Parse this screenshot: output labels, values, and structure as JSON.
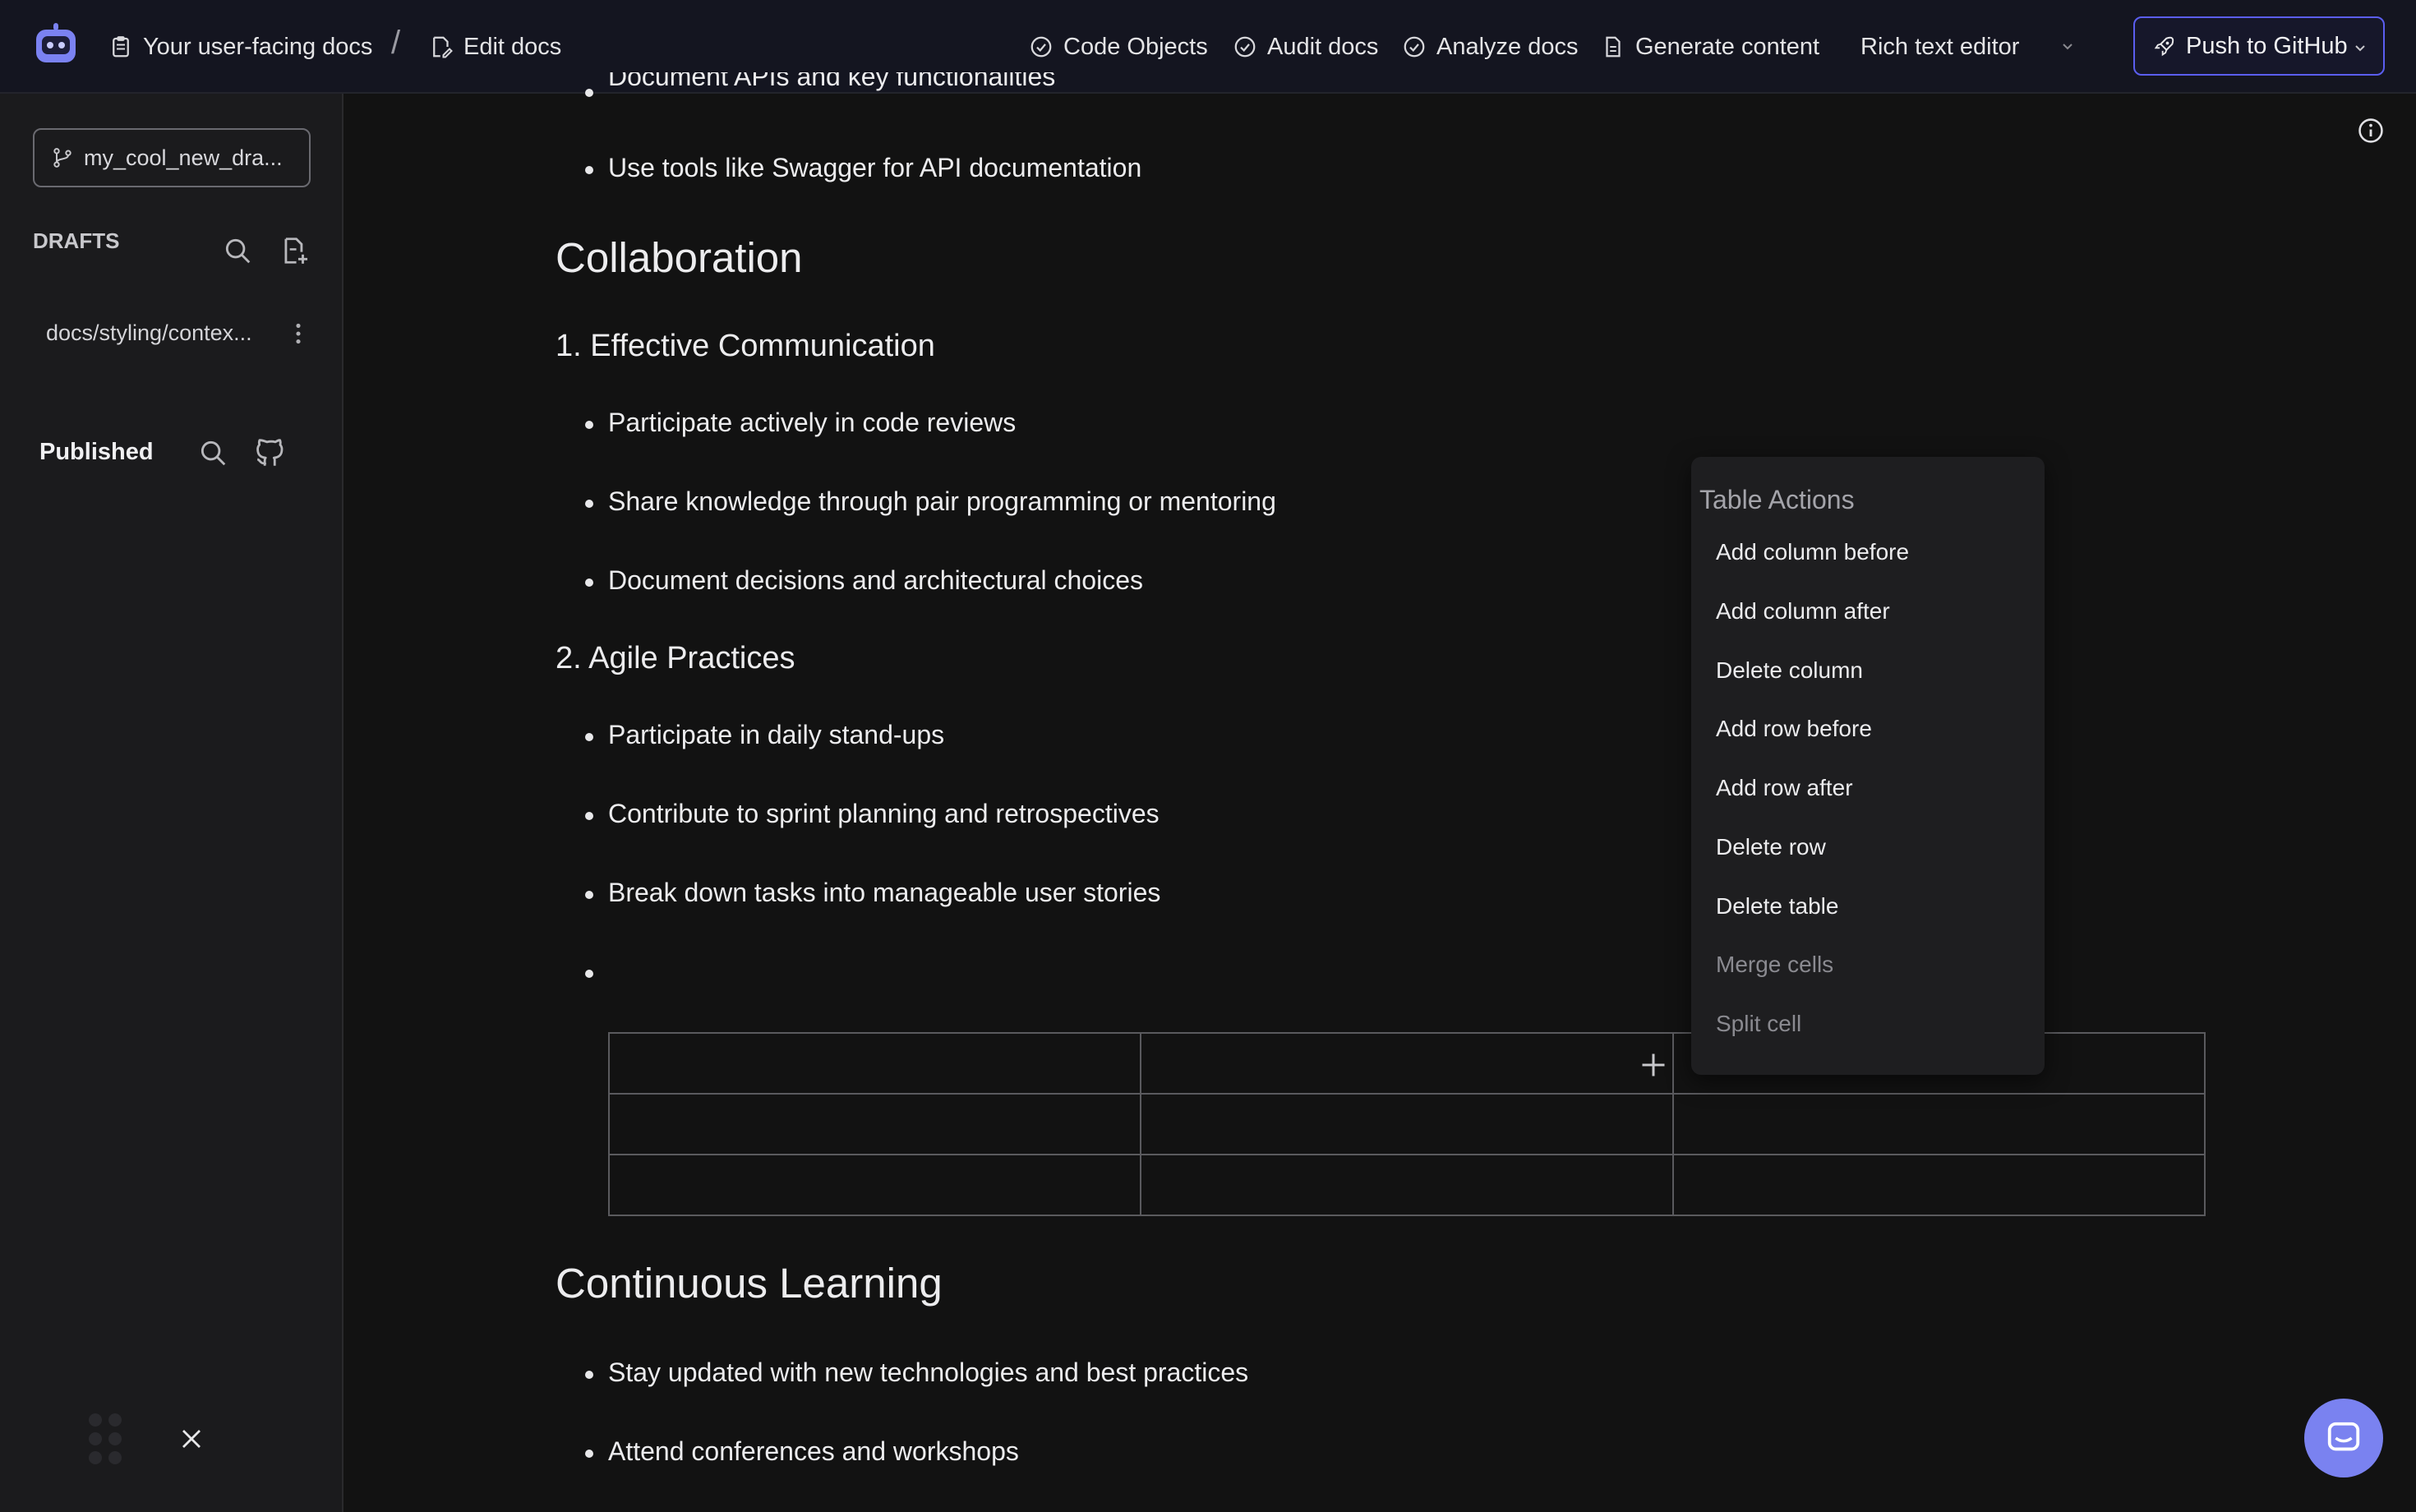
{
  "topbar": {
    "breadcrumb_root": "Your user-facing docs",
    "breadcrumb_sep": "/",
    "breadcrumb_current": "Edit docs",
    "nav": [
      {
        "label": "Code Objects",
        "icon": "check-circle-icon"
      },
      {
        "label": "Audit docs",
        "icon": "check-circle-icon"
      },
      {
        "label": "Analyze docs",
        "icon": "check-circle-icon"
      },
      {
        "label": "Generate content",
        "icon": "document-icon"
      }
    ],
    "editor_mode": "Rich text editor",
    "push_label": "Push to GitHub",
    "accent": "#5b5ef0"
  },
  "sidebar": {
    "branch": "my_cool_new_dra...",
    "drafts_label": "DRAFTS",
    "draft_items": [
      "docs/styling/contex..."
    ],
    "published_label": "Published"
  },
  "document": {
    "partial_line": "Document APIs and key functionalities",
    "bullet_swagger": "Use tools like Swagger for API documentation",
    "h_collab": "Collaboration",
    "h_comm": "1. Effective Communication",
    "comm_items": [
      "Participate actively in code reviews",
      "Share knowledge through pair programming or mentoring",
      "Document decisions and architectural choices"
    ],
    "h_agile": "2. Agile Practices",
    "agile_items": [
      "Participate in daily stand-ups",
      "Contribute to sprint planning and retrospectives",
      "Break down tasks into manageable user stories"
    ],
    "h_learning": "Continuous Learning",
    "learning_items": [
      "Stay updated with new technologies and best practices",
      "Attend conferences and workshops"
    ]
  },
  "table_menu": {
    "title": "Table Actions",
    "items": [
      {
        "label": "Add column before",
        "enabled": true
      },
      {
        "label": "Add column after",
        "enabled": true
      },
      {
        "label": "Delete column",
        "enabled": true
      },
      {
        "label": "Add row before",
        "enabled": true
      },
      {
        "label": "Add row after",
        "enabled": true
      },
      {
        "label": "Delete row",
        "enabled": true
      },
      {
        "label": "Delete table",
        "enabled": true
      },
      {
        "label": "Merge cells",
        "enabled": false
      },
      {
        "label": "Split cell",
        "enabled": false
      }
    ]
  },
  "colors": {
    "background": "#121212",
    "sidebar": "#1b1b1d",
    "menu_bg": "#1e1e20",
    "chat_button": "#7a82f0"
  }
}
